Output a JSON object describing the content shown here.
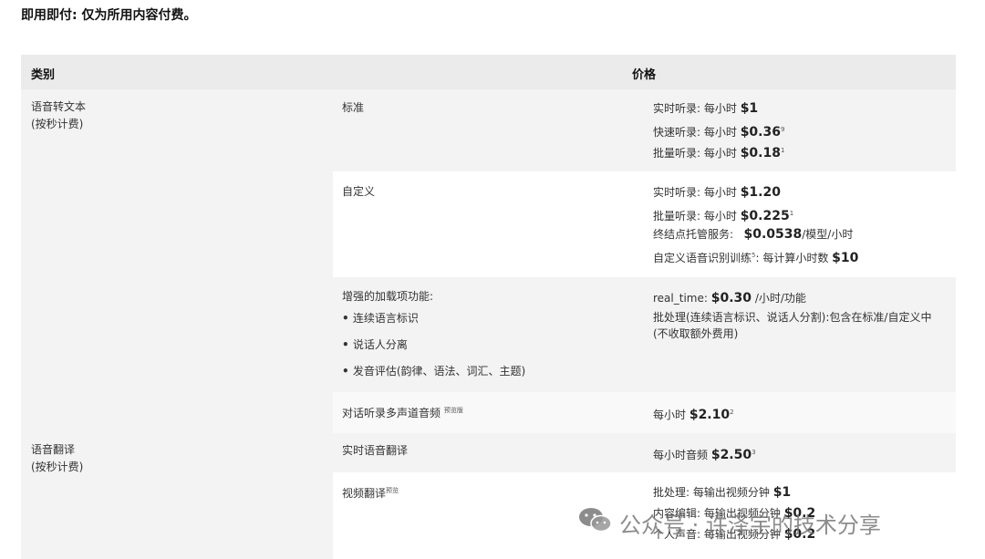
{
  "heading": "即用即付: 仅为所用内容付费。",
  "table": {
    "col_category": "类别",
    "col_price": "价格",
    "categories": [
      {
        "line1": "语音转文本",
        "line2": "(按秒计费)"
      },
      {
        "line1": "语音翻译",
        "line2": "(按秒计费)"
      }
    ],
    "rows": [
      {
        "feature": "标准",
        "prices": [
          {
            "prefix": "实时听录: 每小时 ",
            "amount": "$1",
            "sup": "",
            "suffix": ""
          },
          {
            "prefix": "快速听录: 每小时 ",
            "amount": "$0.36",
            "sup": "9",
            "suffix": ""
          },
          {
            "prefix": "批量听录: 每小时 ",
            "amount": "$0.18",
            "sup": "1",
            "suffix": ""
          }
        ]
      },
      {
        "feature": "自定义",
        "prices": [
          {
            "prefix": "实时听录: 每小时 ",
            "amount": "$1.20",
            "sup": "",
            "suffix": ""
          },
          {
            "prefix": "批量听录: 每小时 ",
            "amount": "$0.225",
            "sup": "1",
            "suffix": ""
          },
          {
            "prefix": "终结点托管服务: ",
            "amount": "$0.0538",
            "sup": "",
            "suffix": "/模型/小时"
          },
          {
            "prefix": "自定义语音识别训练",
            "sup_mid": "5",
            "prefix2": ": 每计算小时数 ",
            "amount": "$10",
            "suffix": ""
          }
        ]
      },
      {
        "feature": "增强的加载项功能:",
        "bullets": [
          "连续语言标识",
          "说话人分离",
          "发音评估(韵律、语法、词汇、主题)"
        ],
        "prices": [
          {
            "prefix": "real_time: ",
            "amount": "$0.30",
            "suffix": " /小时/功能"
          }
        ],
        "note": "批处理(连续语言标识、说话人分割):包含在标准/自定义中(不收取额外费用)"
      },
      {
        "feature": "对话听录多声道音频",
        "feature_tag": "预览版",
        "prices": [
          {
            "prefix": "每小时 ",
            "amount": "$2.10",
            "sup": "2"
          }
        ]
      },
      {
        "feature": "实时语音翻译",
        "prices": [
          {
            "prefix": "每小时音频 ",
            "amount": "$2.50",
            "sup": "3"
          }
        ]
      },
      {
        "feature": "视频翻译",
        "feature_tag": "预览",
        "prices": [
          {
            "prefix": "批处理: 每输出视频分钟 ",
            "amount": "$1"
          },
          {
            "prefix": "内容编辑: 每输出视频分钟 ",
            "amount": "$0.2"
          },
          {
            "prefix": "个人声音: 每输出视频分钟 ",
            "amount": "$0.2"
          }
        ]
      }
    ]
  },
  "watermark": {
    "text": "公众号 · 许泽宇的技术分享",
    "icon": "wechat-icon"
  }
}
